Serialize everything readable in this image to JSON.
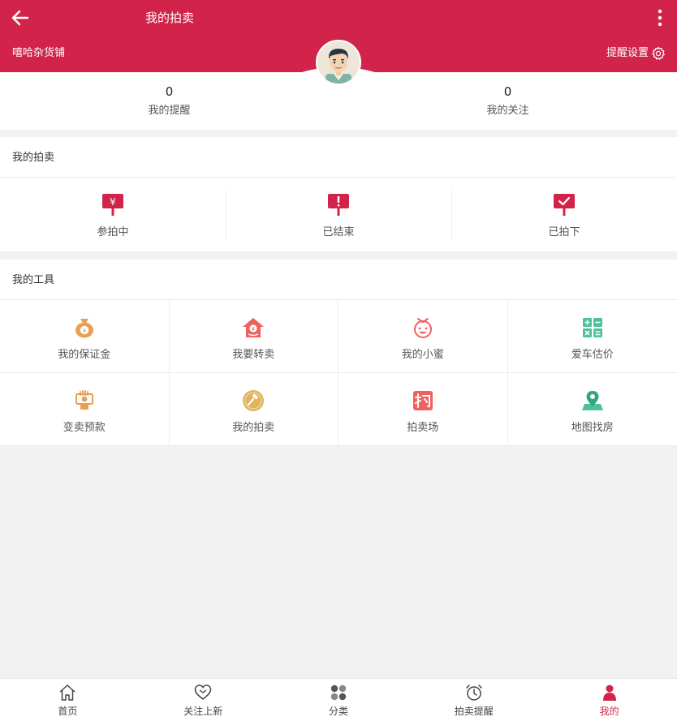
{
  "header": {
    "title": "我的拍卖",
    "shop_name": "嘻哈杂货铺",
    "settings_label": "提醒设置"
  },
  "stats": [
    {
      "count": "0",
      "label": "我的提醒"
    },
    {
      "count": "0",
      "label": "我的关注"
    }
  ],
  "my_auction": {
    "title": "我的拍卖",
    "items": [
      {
        "label": "参拍中",
        "icon": "yen-sign-icon"
      },
      {
        "label": "已结束",
        "icon": "exclamation-sign-icon"
      },
      {
        "label": "已拍下",
        "icon": "check-sign-icon"
      }
    ]
  },
  "tools": {
    "title": "我的工具",
    "items": [
      {
        "label": "我的保证金",
        "icon": "money-bag-icon"
      },
      {
        "label": "我要转卖",
        "icon": "house-resell-icon"
      },
      {
        "label": "我的小蜜",
        "icon": "assistant-face-icon"
      },
      {
        "label": "爱车估价",
        "icon": "calculator-icon"
      },
      {
        "label": "变卖预款",
        "icon": "hand-money-icon"
      },
      {
        "label": "我的拍卖",
        "icon": "gavel-coin-icon"
      },
      {
        "label": "拍卖场",
        "icon": "auction-hall-icon"
      },
      {
        "label": "地图找房",
        "icon": "map-pin-icon"
      }
    ]
  },
  "tabbar": [
    {
      "label": "首页",
      "icon": "home-icon"
    },
    {
      "label": "关注上新",
      "icon": "heart-icon"
    },
    {
      "label": "分类",
      "icon": "category-icon"
    },
    {
      "label": "拍卖提醒",
      "icon": "alarm-clock-icon"
    },
    {
      "label": "我的",
      "icon": "user-icon",
      "active": true
    }
  ],
  "colors": {
    "brand": "#d2244a",
    "tool_orange": "#e8a055",
    "tool_red": "#f0605e",
    "tool_green": "#4dc29a"
  }
}
